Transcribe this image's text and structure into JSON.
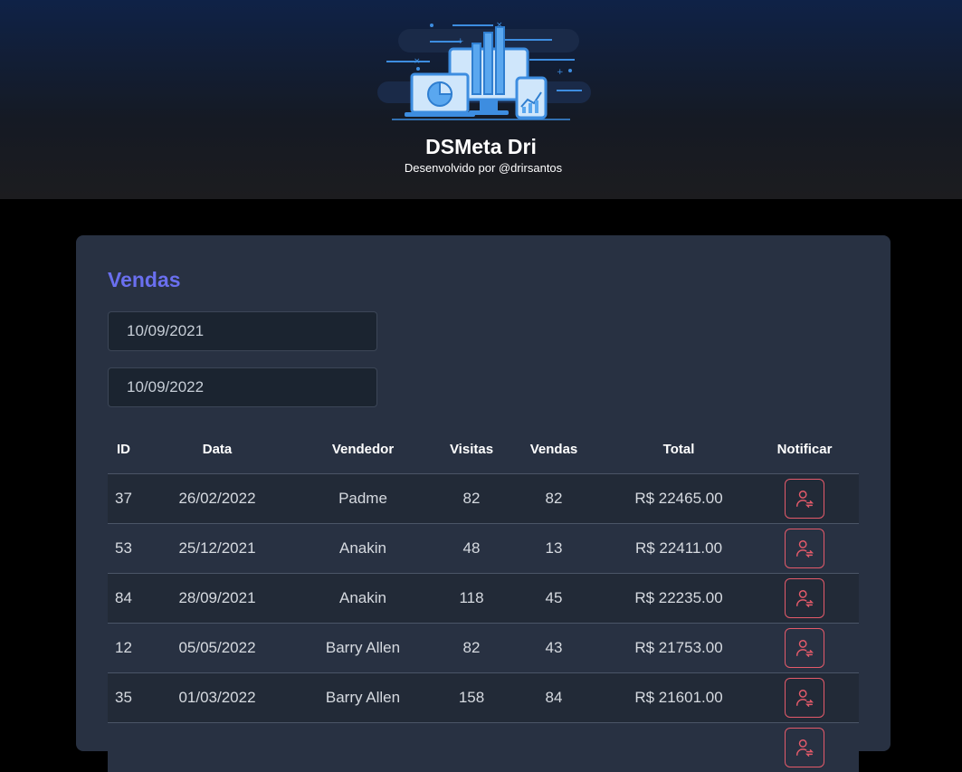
{
  "header": {
    "title": "DSMeta Dri",
    "subtitle": "Desenvolvido por @drirsantos",
    "logo_icon": "dashboard-illustration-icon"
  },
  "sales": {
    "title": "Vendas",
    "min_date": "10/09/2021",
    "max_date": "10/09/2022",
    "columns": [
      "ID",
      "Data",
      "Vendedor",
      "Visitas",
      "Vendas",
      "Total",
      "Notificar"
    ],
    "rows": [
      {
        "id": "37",
        "date": "26/02/2022",
        "seller": "Padme",
        "visited": "82",
        "deals": "82",
        "total": "R$ 22465.00"
      },
      {
        "id": "53",
        "date": "25/12/2021",
        "seller": "Anakin",
        "visited": "48",
        "deals": "13",
        "total": "R$ 22411.00"
      },
      {
        "id": "84",
        "date": "28/09/2021",
        "seller": "Anakin",
        "visited": "118",
        "deals": "45",
        "total": "R$ 22235.00"
      },
      {
        "id": "12",
        "date": "05/05/2022",
        "seller": "Barry Allen",
        "visited": "82",
        "deals": "43",
        "total": "R$ 21753.00"
      },
      {
        "id": "35",
        "date": "01/03/2022",
        "seller": "Barry Allen",
        "visited": "158",
        "deals": "84",
        "total": "R$ 21601.00"
      },
      {
        "id": "",
        "date": "",
        "seller": "",
        "visited": "",
        "deals": "",
        "total": ""
      }
    ],
    "notify_icon": "notify-user-icon"
  },
  "colors": {
    "header_top": "#0f2247",
    "page_bg": "#000000",
    "card_bg": "#283142",
    "accent": "#6a6fef",
    "notify_red": "#e35a6a"
  }
}
